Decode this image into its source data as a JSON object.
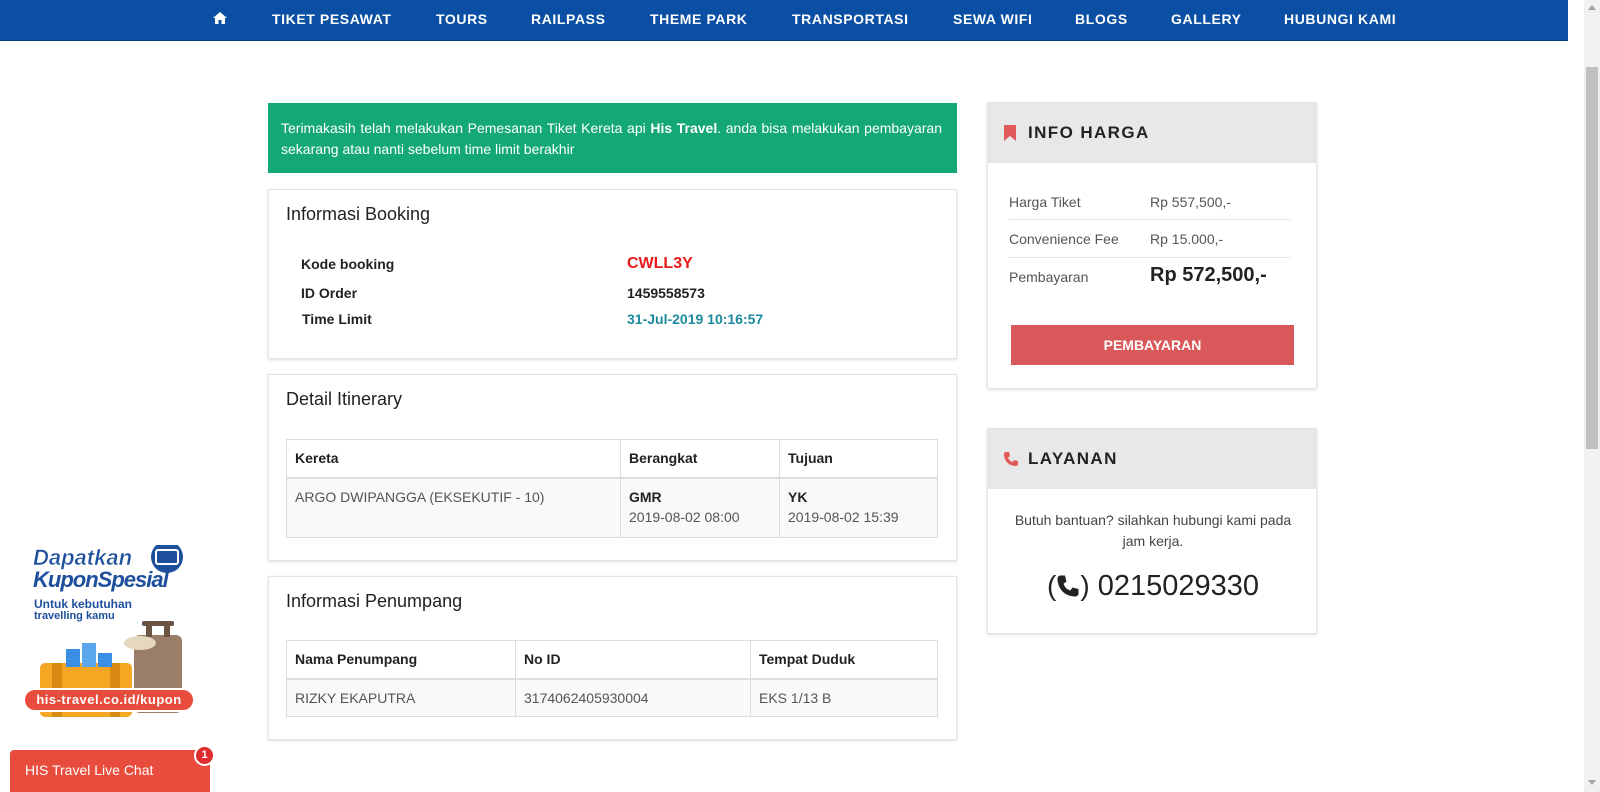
{
  "nav": {
    "home_icon": "home-icon",
    "items": [
      "TIKET PESAWAT",
      "TOURS",
      "RAILPASS",
      "THEME PARK",
      "TRANSPORTASI",
      "SEWA WIFI",
      "BLOGS",
      "GALLERY",
      "HUBUNGI KAMI"
    ]
  },
  "notice": {
    "text_before": "Terimakasih telah melakukan Pemesanan Tiket Kereta api ",
    "brand": "His Travel",
    "text_after": ". anda bisa melakukan pembayaran sekarang atau nanti sebelum time limit berakhir"
  },
  "booking": {
    "title": "Informasi Booking",
    "rows": [
      {
        "label": "Kode booking",
        "value": "CWLL3Y"
      },
      {
        "label": "ID Order",
        "value": "1459558573"
      },
      {
        "label": "Time Limit",
        "value": "31-Jul-2019 10:16:57"
      }
    ]
  },
  "itinerary": {
    "title": "Detail Itinerary",
    "headers": [
      "Kereta",
      "Berangkat",
      "Tujuan"
    ],
    "row": {
      "train": "ARGO DWIPANGGA (EKSEKUTIF - 10)",
      "dep_code": "GMR",
      "dep_time": "2019-08-02 08:00",
      "arr_code": "YK",
      "arr_time": "2019-08-02 15:39"
    }
  },
  "passenger": {
    "title": "Informasi Penumpang",
    "headers": [
      "Nama Penumpang",
      "No ID",
      "Tempat Duduk"
    ],
    "row": {
      "name": "RIZKY EKAPUTRA",
      "id": "3174062405930004",
      "seat": "EKS 1/13 B"
    }
  },
  "price": {
    "title": "INFO HARGA",
    "rows": [
      {
        "label": "Harga Tiket",
        "value": "Rp 557,500,-"
      },
      {
        "label": "Convenience Fee",
        "value": "Rp 15.000,-"
      },
      {
        "label": "Pembayaran",
        "value": "Rp 572,500,-"
      }
    ],
    "button": "PEMBAYARAN"
  },
  "service": {
    "title": "LAYANAN",
    "help": "Butuh bantuan? silahkan hubungi kami pada jam kerja.",
    "phone": "0215029330"
  },
  "promo": {
    "line1": "Dapatkan",
    "line2": "KuponSpesial",
    "line3": "Untuk kebutuhan",
    "line4": "travelling kamu",
    "url": "his-travel.co.id/kupon"
  },
  "chat": {
    "label": "HIS Travel Live Chat",
    "badge": "1"
  },
  "colors": {
    "nav": "#0a4fa3",
    "notice": "#13a874",
    "accent_red": "#d9585a",
    "teal": "#1a8a9c"
  }
}
